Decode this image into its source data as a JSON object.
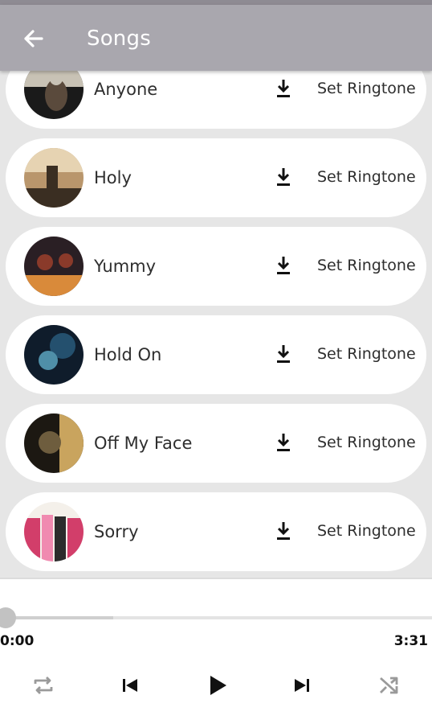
{
  "header": {
    "title": "Songs"
  },
  "songs": [
    {
      "title": "Anyone",
      "ringtone_label": "Set Ringtone",
      "thumb_colors": [
        "#1a1a1a",
        "#5a4a3c",
        "#c8c2b5"
      ]
    },
    {
      "title": "Holy",
      "ringtone_label": "Set Ringtone",
      "thumb_colors": [
        "#3a2e22",
        "#b9966c",
        "#e6d3b2"
      ]
    },
    {
      "title": "Yummy",
      "ringtone_label": "Set Ringtone",
      "thumb_colors": [
        "#2a1f24",
        "#8a3a2a",
        "#d98a3a"
      ]
    },
    {
      "title": "Hold On",
      "ringtone_label": "Set Ringtone",
      "thumb_colors": [
        "#0f1c2b",
        "#24506e",
        "#4f8fa8"
      ]
    },
    {
      "title": "Off My Face",
      "ringtone_label": "Set Ringtone",
      "thumb_colors": [
        "#1c1812",
        "#6e5d3e",
        "#c9a45e"
      ]
    },
    {
      "title": "Sorry",
      "ringtone_label": "Set Ringtone",
      "thumb_colors": [
        "#d23e6a",
        "#2c2c2c",
        "#f08ab0"
      ]
    }
  ],
  "player": {
    "current_time": "0:00",
    "duration": "3:31",
    "progress": 0.0,
    "buffered": 0.25
  },
  "colors": {
    "appbar": "#a9a7ae",
    "background": "#e6e6e6",
    "card": "#ffffff",
    "text": "#2e2e2e",
    "icon": "#111111",
    "icon_muted": "#9a9a9a"
  }
}
